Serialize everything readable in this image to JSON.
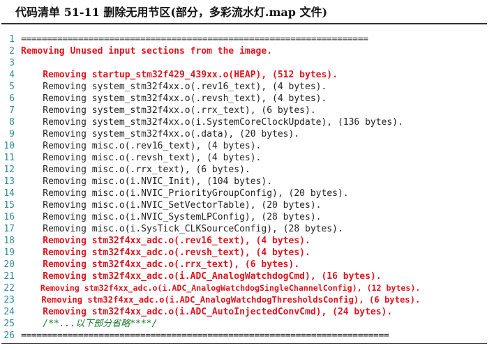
{
  "caption": "代码清单 51-11 删除无用节区(部分，多彩流水灯.map 文件)",
  "lines": [
    {
      "n": "1",
      "t": "===================================================================",
      "style": "dash"
    },
    {
      "n": "2",
      "t": "Removing Unused input sections from the image.",
      "style": "red"
    },
    {
      "n": "3",
      "t": "",
      "style": "normal"
    },
    {
      "n": "4",
      "t": "    Removing startup_stm32f429_439xx.o(HEAP), (512 bytes).",
      "style": "red"
    },
    {
      "n": "5",
      "t": "    Removing system_stm32f4xx.o(.rev16_text), (4 bytes).",
      "style": "normal"
    },
    {
      "n": "6",
      "t": "    Removing system_stm32f4xx.o(.revsh_text), (4 bytes).",
      "style": "normal"
    },
    {
      "n": "7",
      "t": "    Removing system_stm32f4xx.o(.rrx_text), (6 bytes).",
      "style": "normal"
    },
    {
      "n": "8",
      "t": "    Removing system_stm32f4xx.o(i.SystemCoreClockUpdate), (136 bytes).",
      "style": "normal"
    },
    {
      "n": "9",
      "t": "    Removing system_stm32f4xx.o(.data), (20 bytes).",
      "style": "normal"
    },
    {
      "n": "10",
      "t": "    Removing misc.o(.rev16_text), (4 bytes).",
      "style": "normal"
    },
    {
      "n": "11",
      "t": "    Removing misc.o(.revsh_text), (4 bytes).",
      "style": "normal"
    },
    {
      "n": "12",
      "t": "    Removing misc.o(.rrx_text), (6 bytes).",
      "style": "normal"
    },
    {
      "n": "13",
      "t": "    Removing misc.o(i.NVIC_Init), (104 bytes).",
      "style": "normal"
    },
    {
      "n": "14",
      "t": "    Removing misc.o(i.NVIC_PriorityGroupConfig), (20 bytes).",
      "style": "normal"
    },
    {
      "n": "15",
      "t": "    Removing misc.o(i.NVIC_SetVectorTable), (20 bytes).",
      "style": "normal"
    },
    {
      "n": "16",
      "t": "    Removing misc.o(i.NVIC_SystemLPConfig), (28 bytes).",
      "style": "normal"
    },
    {
      "n": "17",
      "t": "    Removing misc.o(i.SysTick_CLKSourceConfig), (28 bytes).",
      "style": "normal"
    },
    {
      "n": "18",
      "t": "    Removing stm32f4xx_adc.o(.rev16_text), (4 bytes).",
      "style": "red"
    },
    {
      "n": "19",
      "t": "    Removing stm32f4xx_adc.o(.revsh_text), (4 bytes).",
      "style": "red"
    },
    {
      "n": "20",
      "t": "    Removing stm32f4xx_adc.o(.rrx_text), (6 bytes).",
      "style": "red"
    },
    {
      "n": "21",
      "t": "    Removing stm32f4xx_adc.o(i.ADC_AnalogWatchdogCmd), (16 bytes).",
      "style": "red"
    },
    {
      "n": "22",
      "t": "    Removing stm32f4xx_adc.o(i.ADC_AnalogWatchdogSingleChannelConfig), (12 bytes).",
      "style": "red-xs"
    },
    {
      "n": "23",
      "t": "    Removing stm32f4xx_adc.o(i.ADC_AnalogWatchdogThresholdsConfig), (6 bytes).",
      "style": "red-sm"
    },
    {
      "n": "24",
      "t": "    Removing stm32f4xx_adc.o(i.ADC_AutoInjectedConvCmd), (24 bytes).",
      "style": "red"
    },
    {
      "n": "25",
      "t": "    /**...以下部分省略****/",
      "style": "comment"
    },
    {
      "n": "26",
      "t": "=======================================================================",
      "style": "dash"
    }
  ]
}
